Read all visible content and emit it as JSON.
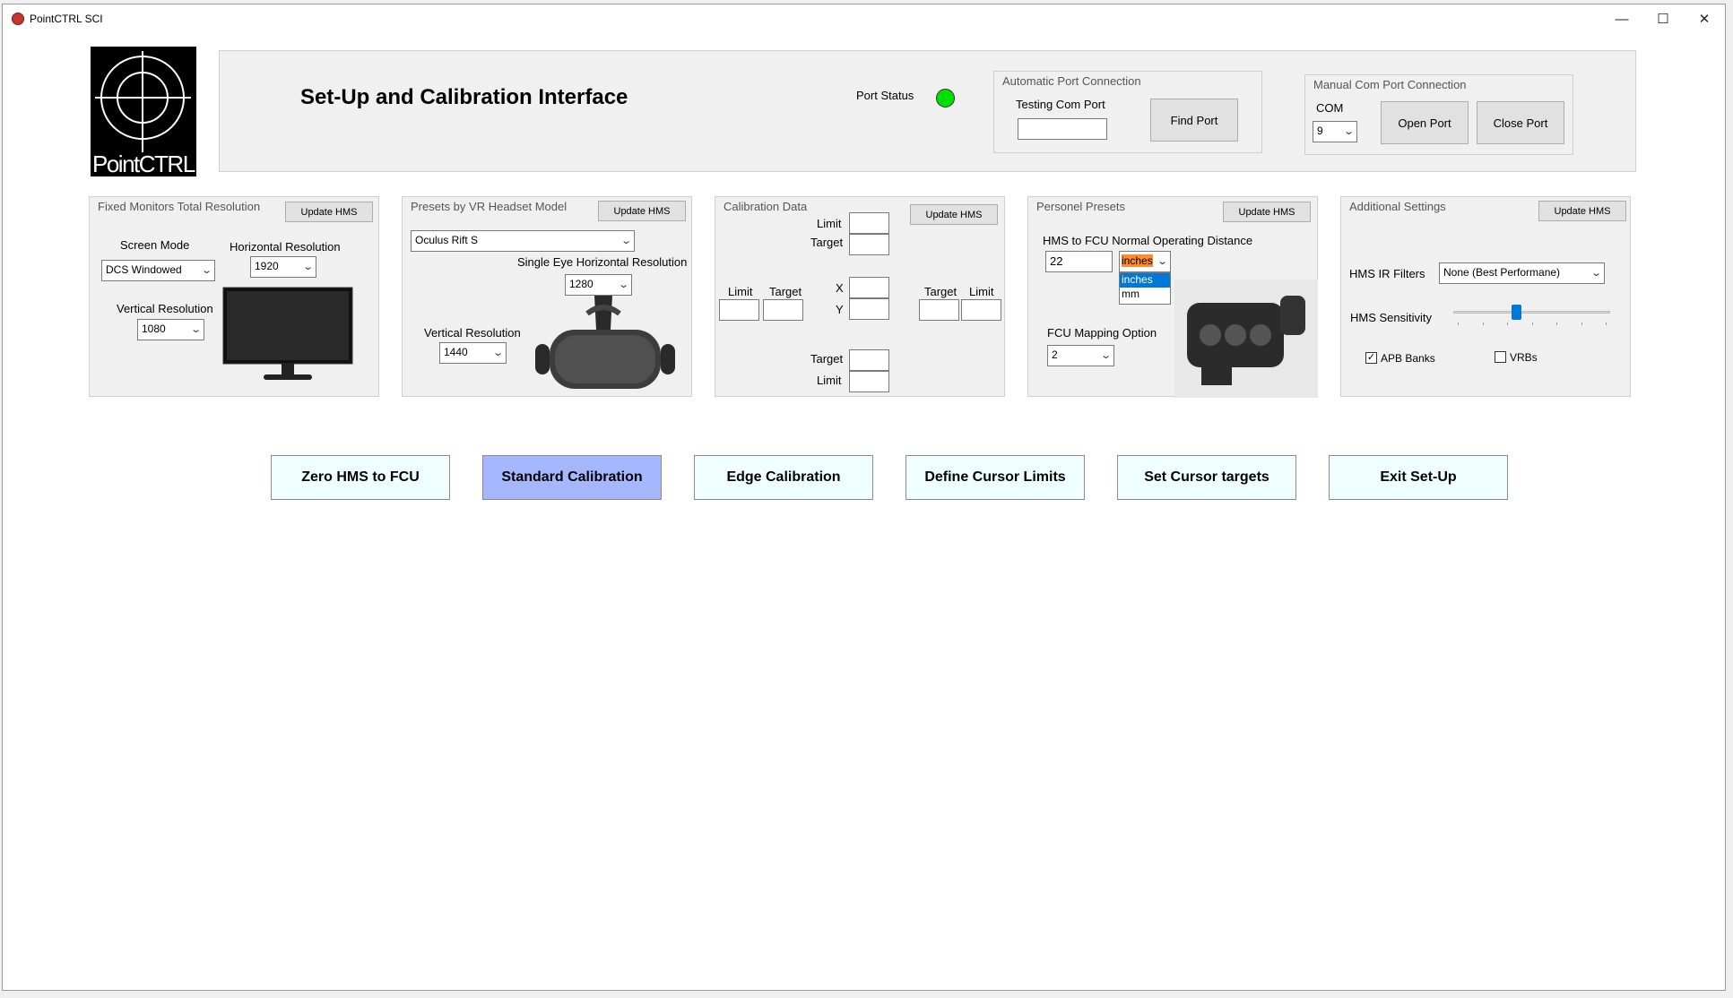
{
  "window": {
    "title": "PointCTRL SCI",
    "minimize": "—",
    "maximize": "☐",
    "close": "✕"
  },
  "logo": {
    "text": "PointCTRL"
  },
  "header": {
    "title": "Set-Up and Calibration Interface",
    "port_status_label": "Port Status",
    "port_status_color": "#00e000",
    "auto_group": "Automatic Port Connection",
    "testing_label": "Testing Com Port",
    "testing_value": "",
    "find_port": "Find Port",
    "manual_group": "Manual Com Port Connection",
    "com_label": "COM",
    "com_value": "9",
    "open_port": "Open Port",
    "close_port": "Close Port"
  },
  "monitors": {
    "group": "Fixed Monitors Total  Resolution",
    "update": "Update HMS",
    "screen_mode_label": "Screen Mode",
    "screen_mode_value": "DCS Windowed",
    "h_res_label": "Horizontal Resolution",
    "h_res_value": "1920",
    "v_res_label": "Vertical Resolution",
    "v_res_value": "1080"
  },
  "vr": {
    "group": "Presets by VR Headset Model",
    "update": "Update HMS",
    "model_value": "Oculus Rift S",
    "single_eye_label": "Single Eye Horizontal Resolution",
    "single_eye_value": "1280",
    "v_res_label": "Vertical Resolution",
    "v_res_value": "1440"
  },
  "calibration": {
    "group": "Calibration Data",
    "update": "Update HMS",
    "limit": "Limit",
    "target": "Target",
    "x": "X",
    "y": "Y"
  },
  "personel": {
    "group": "Personel Presets",
    "update": "Update HMS",
    "distance_label": "HMS to FCU Normal Operating Distance",
    "distance_value": "22",
    "unit_value": "inches",
    "unit_options": [
      "inches",
      "mm"
    ],
    "mapping_label": "FCU Mapping Option",
    "mapping_value": "2"
  },
  "additional": {
    "group": "Additional Settings",
    "update": "Update HMS",
    "ir_label": "HMS IR Filters",
    "ir_value": "None  (Best Performane)",
    "sensitivity_label": "HMS Sensitivity",
    "sensitivity_level": 0.4,
    "apb_label": "APB Banks",
    "apb_checked": true,
    "vrb_label": "VRBs",
    "vrb_checked": false
  },
  "actions": {
    "zero": "Zero HMS to FCU",
    "standard": "Standard Calibration",
    "edge": "Edge Calibration",
    "define": "Define Cursor Limits",
    "set_targets": "Set Cursor targets",
    "exit": "Exit Set-Up",
    "active_color": "#a5b8ff"
  }
}
